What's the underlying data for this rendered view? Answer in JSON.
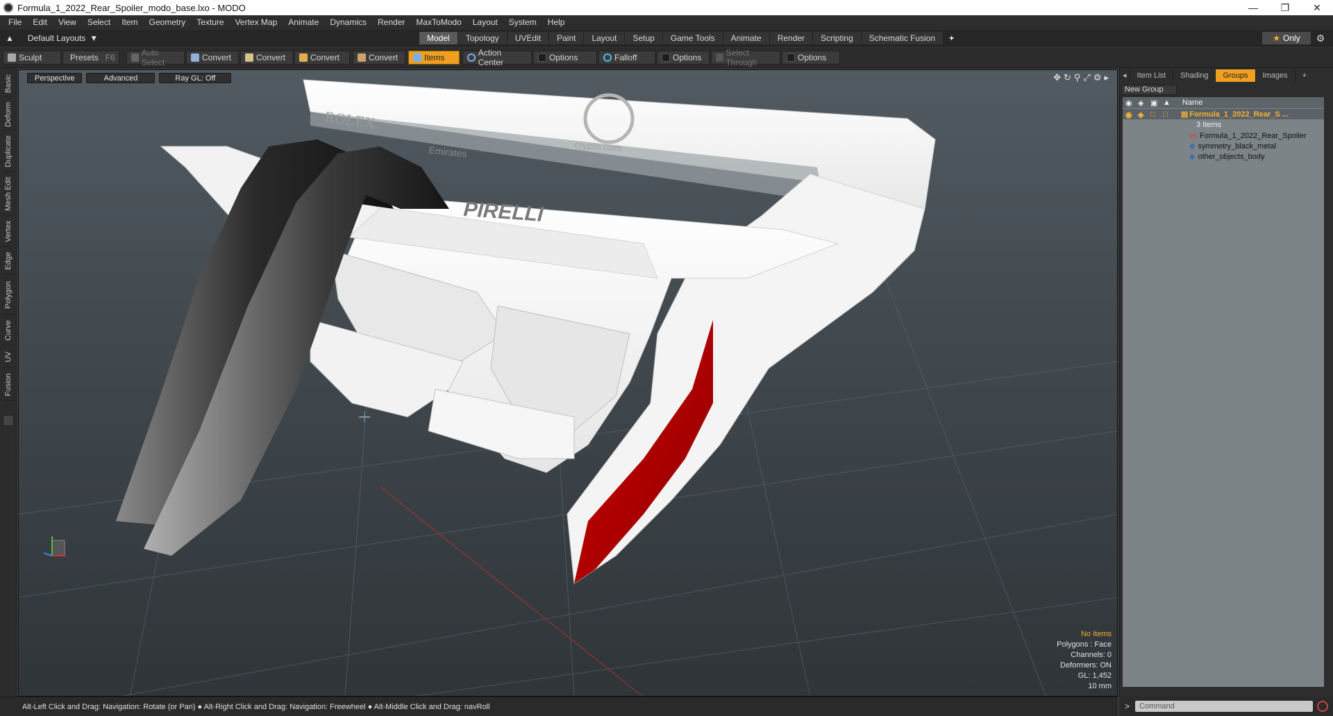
{
  "window": {
    "title": "Formula_1_2022_Rear_Spoiler_modo_base.lxo - MODO"
  },
  "menu": [
    "File",
    "Edit",
    "View",
    "Select",
    "Item",
    "Geometry",
    "Texture",
    "Vertex Map",
    "Animate",
    "Dynamics",
    "Render",
    "MaxToModo",
    "Layout",
    "System",
    "Help"
  ],
  "layout": {
    "dropdown": "Default Layouts",
    "only_label": "Only"
  },
  "tabs": [
    "Model",
    "Topology",
    "UVEdit",
    "Paint",
    "Layout",
    "Setup",
    "Game Tools",
    "Animate",
    "Render",
    "Scripting",
    "Schematic Fusion"
  ],
  "toolbar": {
    "sculpt": "Sculpt",
    "presets": "Presets",
    "presets_key": "F6",
    "auto_select": "Auto Select",
    "convert1": "Convert",
    "convert2": "Convert",
    "convert3": "Convert",
    "convert4": "Convert",
    "items": "Items",
    "action_center": "Action Center",
    "options1": "Options",
    "falloff": "Falloff",
    "options2": "Options",
    "select_through": "Select Through",
    "options3": "Options"
  },
  "left_tabs": [
    "Basic",
    "Deform",
    "Duplicate",
    "Mesh Edit",
    "Vertex",
    "Edge",
    "Polygon",
    "Curve",
    "UV",
    "Fusion"
  ],
  "viewport": {
    "perspective": "Perspective",
    "advanced": "Advanced",
    "raygl": "Ray GL: Off",
    "logos": {
      "rolex": "ROLEX",
      "emirates": "Emirates",
      "crypto": "crypto.com",
      "pirelli": "PIRELLI"
    },
    "stats": {
      "items": "No Items",
      "polygons": "Polygons : Face",
      "channels": "Channels: 0",
      "deformers": "Deformers: ON",
      "gl": "GL: 1,452",
      "scale": "10 mm"
    }
  },
  "status": "Alt-Left Click and Drag: Navigation: Rotate (or Pan) ● Alt-Right Click and Drag: Navigation: Freewheel ● Alt-Middle Click and Drag: navRoll",
  "right_panel": {
    "tabs": [
      "Item List",
      "Shading",
      "Groups",
      "Images"
    ],
    "new_group": "New Group",
    "header_name": "Name",
    "group_name": "Formula_1_2022_Rear_S ...",
    "group_count": "3 Items",
    "items": [
      "Formula_1_2022_Rear_Spoiler",
      "symmetry_black_metal",
      "other_objects_body"
    ]
  },
  "command": {
    "prompt": ">",
    "placeholder": "Command"
  }
}
